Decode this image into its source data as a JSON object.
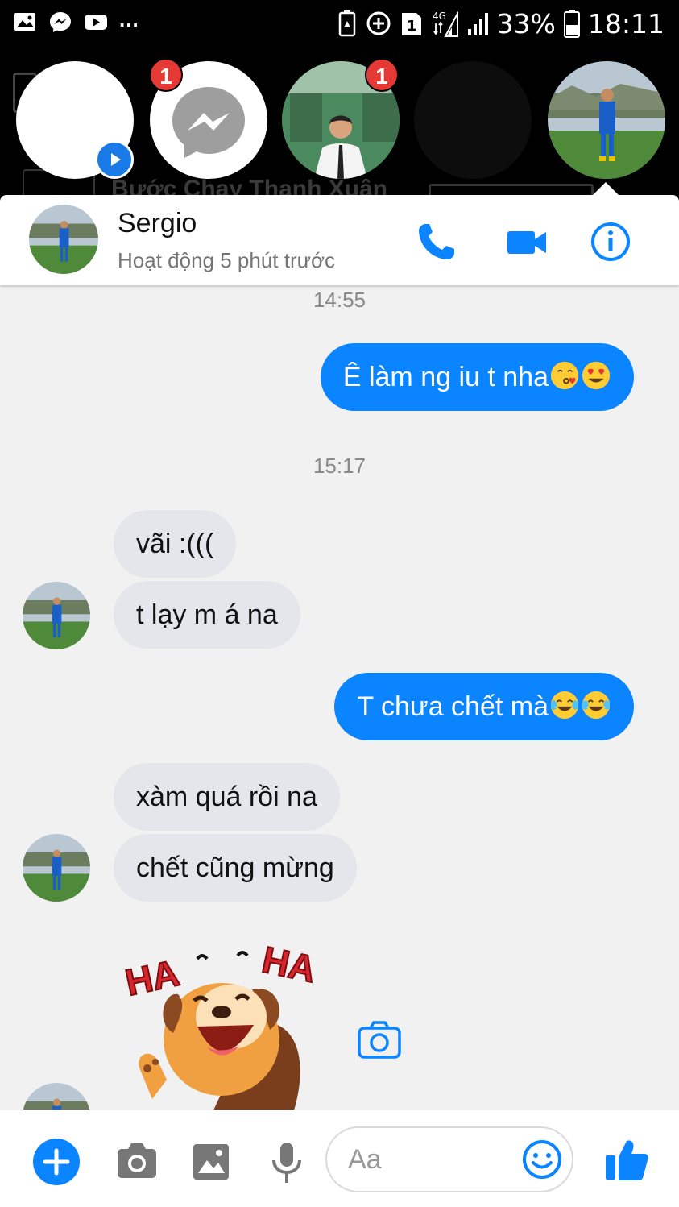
{
  "status_bar": {
    "dots": "...",
    "battery_percent": "33%",
    "time": "18:11",
    "network": "4G"
  },
  "chat_heads": {
    "background_title": "Bước Chạy Thanh Xuân",
    "badges": [
      "1",
      "1"
    ]
  },
  "header": {
    "name": "Sergio",
    "status": "Hoạt động 5 phút trước",
    "accent_color": "#0b84ff"
  },
  "messages": {
    "timestamp_1": "14:55",
    "out_1": "Ê làm ng iu t nha",
    "out_1_emojis": [
      "kissing-face",
      "heart-eyes-face"
    ],
    "timestamp_2": "15:17",
    "in_1": "vãi :(((",
    "in_2": "t lạy m á na",
    "out_2": "T chưa chết mà",
    "out_2_emojis": [
      "tears-of-joy-face",
      "tears-of-joy-face"
    ],
    "in_3": "xàm quá rồi na",
    "in_4": "chết cũng mừng",
    "sticker": "HA HA"
  },
  "composer": {
    "placeholder": "Aa",
    "icons": [
      "plus-icon",
      "camera-icon",
      "image-icon",
      "microphone-icon",
      "emoji-icon",
      "thumbs-up-icon"
    ]
  }
}
